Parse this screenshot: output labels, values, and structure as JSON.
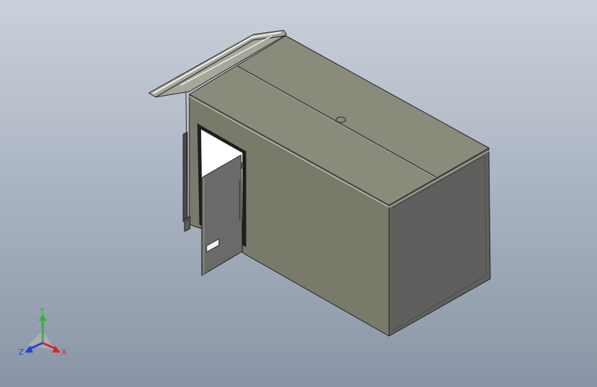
{
  "viewport": {
    "background_top": "#c9d1da",
    "background_bottom": "#8995a6"
  },
  "model": {
    "top_color": "#8b8b7c",
    "front_color": "#7a7a6a",
    "right_color": "#5f5f5d",
    "edge_color": "#1e1e1e",
    "door_color": "#6a6a68",
    "roof_panel_color": "#a6a69a",
    "highlight_color": "#f2f2f2"
  },
  "triad": {
    "x_label": "X",
    "y_label": "Y",
    "z_label": "Z",
    "x_color": "#d8262a",
    "y_color": "#36b040",
    "z_color": "#2a3fd6"
  }
}
